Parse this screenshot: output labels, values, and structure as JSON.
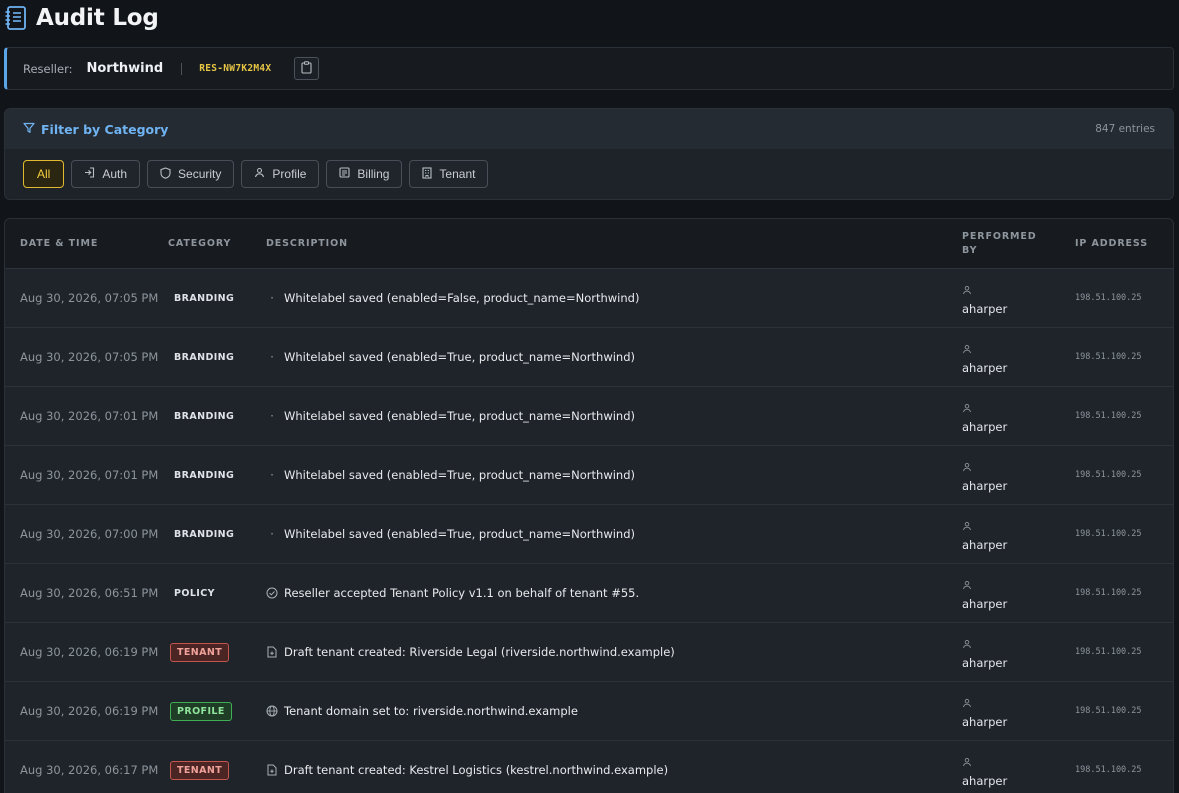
{
  "page": {
    "title": "Audit Log"
  },
  "reseller": {
    "label": "Reseller:",
    "name": "Northwind",
    "code": "RES-NW7K2M4X"
  },
  "filter": {
    "title": "Filter by Category",
    "count": "847 entries",
    "chips": [
      {
        "label": "All",
        "icon": "none",
        "active": true
      },
      {
        "label": "Auth",
        "icon": "login-icon",
        "active": false
      },
      {
        "label": "Security",
        "icon": "shield-icon",
        "active": false
      },
      {
        "label": "Profile",
        "icon": "user-icon",
        "active": false
      },
      {
        "label": "Billing",
        "icon": "receipt-icon",
        "active": false
      },
      {
        "label": "Tenant",
        "icon": "building-icon",
        "active": false
      }
    ]
  },
  "table": {
    "headers": {
      "date": "DATE & TIME",
      "category": "CATEGORY",
      "description": "DESCRIPTION",
      "performed_by": "PERFORMED BY",
      "ip": "IP ADDRESS"
    },
    "rows": [
      {
        "date": "Aug 30, 2026, 07:05 PM",
        "category": "BRANDING",
        "style": "plain",
        "icon": "dot",
        "description": "Whitelabel saved (enabled=False, product_name=Northwind)",
        "user": "aharper",
        "ip": "198.51.100.25"
      },
      {
        "date": "Aug 30, 2026, 07:05 PM",
        "category": "BRANDING",
        "style": "plain",
        "icon": "dot",
        "description": "Whitelabel saved (enabled=True, product_name=Northwind)",
        "user": "aharper",
        "ip": "198.51.100.25"
      },
      {
        "date": "Aug 30, 2026, 07:01 PM",
        "category": "BRANDING",
        "style": "plain",
        "icon": "dot",
        "description": "Whitelabel saved (enabled=True, product_name=Northwind)",
        "user": "aharper",
        "ip": "198.51.100.25"
      },
      {
        "date": "Aug 30, 2026, 07:01 PM",
        "category": "BRANDING",
        "style": "plain",
        "icon": "dot",
        "description": "Whitelabel saved (enabled=True, product_name=Northwind)",
        "user": "aharper",
        "ip": "198.51.100.25"
      },
      {
        "date": "Aug 30, 2026, 07:00 PM",
        "category": "BRANDING",
        "style": "plain",
        "icon": "dot",
        "description": "Whitelabel saved (enabled=True, product_name=Northwind)",
        "user": "aharper",
        "ip": "198.51.100.25"
      },
      {
        "date": "Aug 30, 2026, 06:51 PM",
        "category": "POLICY",
        "style": "plain",
        "icon": "check-circle-icon",
        "description": "Reseller accepted Tenant Policy v1.1 on behalf of tenant #55.",
        "user": "aharper",
        "ip": "198.51.100.25"
      },
      {
        "date": "Aug 30, 2026, 06:19 PM",
        "category": "TENANT",
        "style": "tenant",
        "icon": "file-plus-icon",
        "description": "Draft tenant created: Riverside Legal (riverside.northwind.example)",
        "user": "aharper",
        "ip": "198.51.100.25"
      },
      {
        "date": "Aug 30, 2026, 06:19 PM",
        "category": "PROFILE",
        "style": "profile",
        "icon": "globe-icon",
        "description": "Tenant domain set to: riverside.northwind.example",
        "user": "aharper",
        "ip": "198.51.100.25"
      },
      {
        "date": "Aug 30, 2026, 06:17 PM",
        "category": "TENANT",
        "style": "tenant",
        "icon": "file-plus-icon",
        "description": "Draft tenant created: Kestrel Logistics (kestrel.northwind.example)",
        "user": "aharper",
        "ip": "198.51.100.25"
      }
    ]
  }
}
